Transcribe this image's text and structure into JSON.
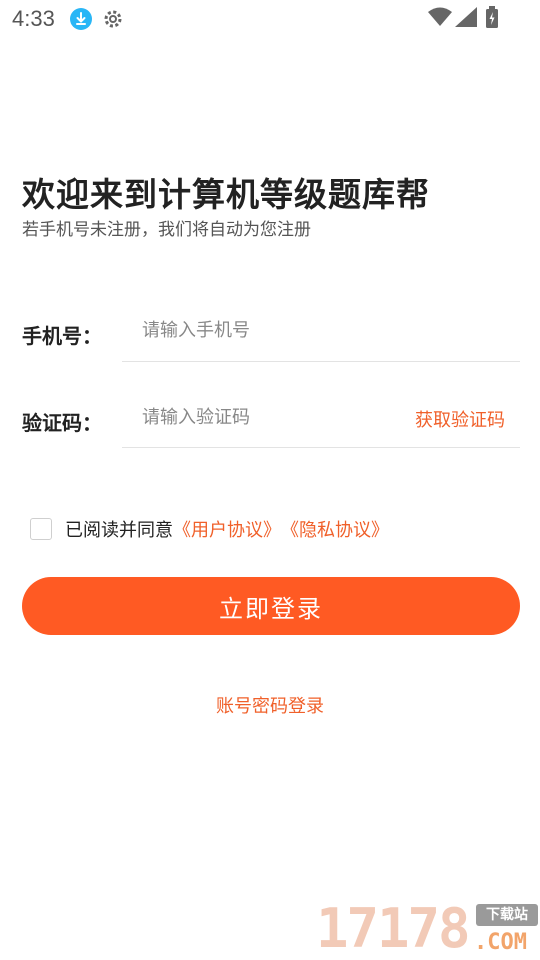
{
  "status_bar": {
    "time": "4:33",
    "icons": [
      "download-icon",
      "gear-icon",
      "wifi-icon",
      "signal-icon",
      "battery-icon"
    ]
  },
  "header": {
    "title": "欢迎来到计算机等级题库帮",
    "subtitle": "若手机号未注册，我们将自动为您注册"
  },
  "form": {
    "phone_label": "手机号：",
    "phone_placeholder": "请输入手机号",
    "code_label": "验证码：",
    "code_placeholder": "请输入验证码",
    "get_code_label": "获取验证码"
  },
  "agreement": {
    "checked": false,
    "text": "已阅读并同意",
    "user_agreement": "《用户协议》",
    "privacy_policy": "《隐私协议》"
  },
  "actions": {
    "login_label": "立即登录",
    "password_login_label": "账号密码登录"
  },
  "watermark": {
    "number": "17178",
    "badge": "下载站",
    "domain": ".COM"
  },
  "colors": {
    "accent": "#ff5a23",
    "link": "#f0602a",
    "download_badge": "#29b6f6"
  }
}
